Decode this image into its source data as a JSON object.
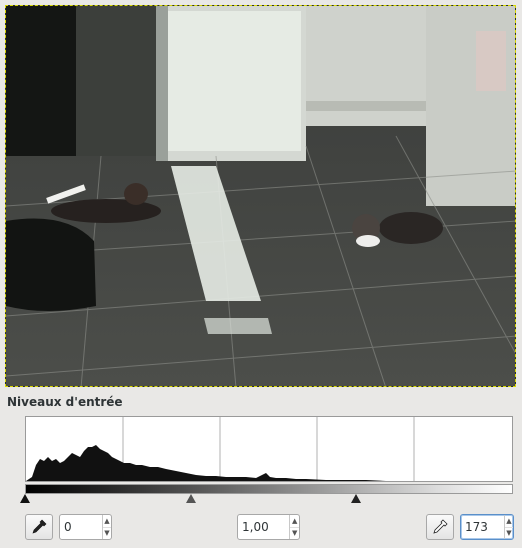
{
  "canvas": {
    "description_icon": "image-canvas"
  },
  "levels": {
    "section_title": "Niveaux d'entrée",
    "low_input": "0",
    "gamma_input": "1,00",
    "high_input": "173",
    "low_value": 0,
    "gamma_value": 1.0,
    "high_value": 173,
    "max_value": 255
  },
  "icons": {
    "low_picker": "eyedropper-black-icon",
    "high_picker": "eyedropper-white-icon"
  },
  "colors": {
    "selection_border": "#d8d800",
    "histogram_fill": "#111111",
    "focus": "#5a8fc9"
  }
}
